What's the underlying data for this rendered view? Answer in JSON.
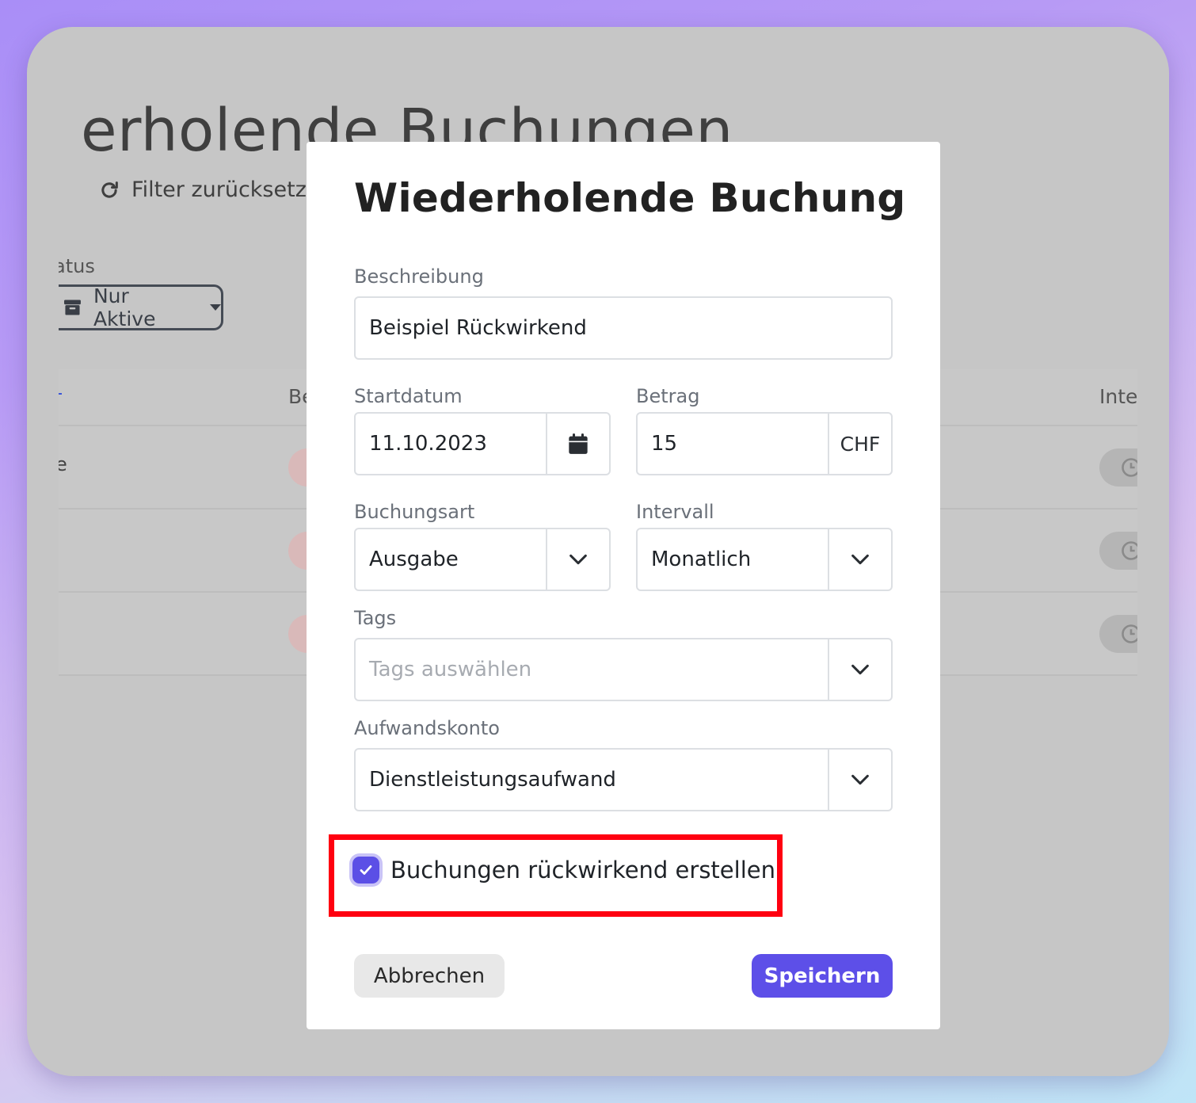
{
  "background": {
    "page_title": "erholende Buchungen",
    "reset_filter_label": "Filter zurücksetz",
    "status_label": "atus",
    "status_select_value": "Nur Aktive",
    "table_headers": {
      "col_be": "Be",
      "col_inte": "Inte"
    },
    "row_fragment": "e"
  },
  "modal": {
    "title": "Wiederholende Buchung",
    "description_label": "Beschreibung",
    "description_value": "Beispiel Rückwirkend",
    "start_date_label": "Startdatum",
    "start_date_value": "11.10.2023",
    "amount_label": "Betrag",
    "amount_value": "15",
    "currency": "CHF",
    "booking_type_label": "Buchungsart",
    "booking_type_value": "Ausgabe",
    "interval_label": "Intervall",
    "interval_value": "Monatlich",
    "tags_label": "Tags",
    "tags_placeholder": "Tags auswählen",
    "expense_account_label": "Aufwandskonto",
    "expense_account_value": "Dienstleistungsaufwand",
    "retroactive_label": "Buchungen rückwirkend erstellen",
    "retroactive_checked": true,
    "cancel_label": "Abbrechen",
    "save_label": "Speichern"
  },
  "colors": {
    "accent": "#5d4fe8",
    "highlight_border": "#ff0010",
    "overlay": "#c6c6c6"
  },
  "icons": [
    "refresh-icon",
    "archive-icon",
    "calendar-icon",
    "chevron-down-icon",
    "clock-icon",
    "checkmark-icon"
  ]
}
